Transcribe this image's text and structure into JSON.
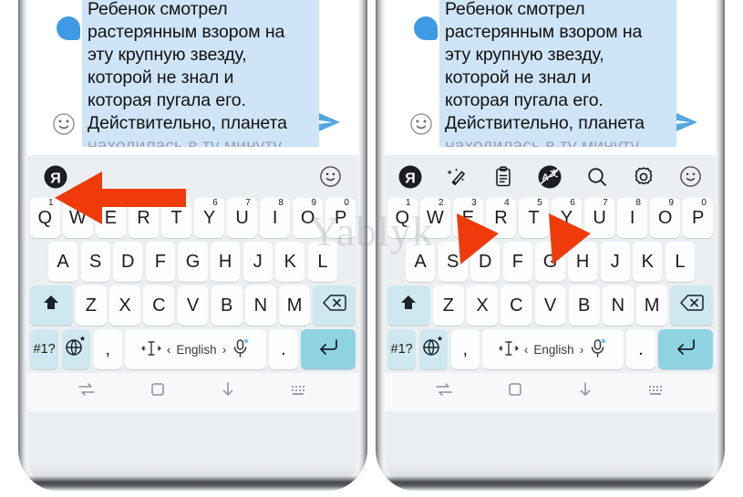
{
  "watermark": "Yablyk",
  "colors": {
    "bubble": "#cfe4f7",
    "avatar": "#3f9ae5",
    "send": "#55a7e0",
    "key_mod": "#cfe7ee",
    "key_enter": "#8fd3e2",
    "keyboard_bg": "#eceff2",
    "arrow": "#ef3b0c",
    "yandex_logo": "#1b1f24"
  },
  "message": {
    "lines": [
      "Ребенок смотрел",
      "растерянным взором на",
      "эту крупную звезду,",
      "которой не знал и",
      "которая пугала его.",
      "Действительно, планета"
    ],
    "clipped_line": "находилась в ту минуту",
    "emoji_button": "emoji-icon",
    "send_button": "send-icon"
  },
  "panels": [
    {
      "id": "left",
      "toolbar": {
        "state": "collapsed",
        "items": [
          {
            "name": "yandex-logo-icon",
            "label": "Я"
          },
          {
            "name": "emoji-icon",
            "label": ""
          }
        ]
      },
      "arrow_target": "yandex-logo-icon"
    },
    {
      "id": "right",
      "toolbar": {
        "state": "expanded",
        "items": [
          {
            "name": "yandex-logo-icon",
            "label": "Я"
          },
          {
            "name": "magic-wand-icon",
            "label": ""
          },
          {
            "name": "clipboard-icon",
            "label": ""
          },
          {
            "name": "translate-icon",
            "label": "A"
          },
          {
            "name": "search-icon",
            "label": ""
          },
          {
            "name": "gear-icon",
            "label": ""
          },
          {
            "name": "emoji-icon",
            "label": ""
          }
        ]
      },
      "arrow_targets": [
        "magic-wand-icon",
        "translate-icon"
      ]
    }
  ],
  "keyboard": {
    "row1": [
      {
        "letter": "Q",
        "num": "1"
      },
      {
        "letter": "W",
        "num": "2"
      },
      {
        "letter": "E",
        "num": "3"
      },
      {
        "letter": "R",
        "num": "4"
      },
      {
        "letter": "T",
        "num": "5"
      },
      {
        "letter": "Y",
        "num": "6"
      },
      {
        "letter": "U",
        "num": "7"
      },
      {
        "letter": "I",
        "num": "8"
      },
      {
        "letter": "O",
        "num": "9"
      },
      {
        "letter": "P",
        "num": "0"
      }
    ],
    "row2": [
      "A",
      "S",
      "D",
      "F",
      "G",
      "H",
      "J",
      "K",
      "L"
    ],
    "row3": {
      "shift": "shift-icon",
      "letters": [
        "Z",
        "X",
        "C",
        "V",
        "B",
        "N",
        "M"
      ],
      "backspace": "backspace-icon"
    },
    "row4": {
      "symbols_label": "#1?",
      "globe": "globe-settings-icon",
      "comma": ",",
      "space": {
        "cursor_icon": "cursor-move-icon",
        "prev": "‹",
        "language": "English",
        "next": "›",
        "mic_icon": "microphone-icon"
      },
      "period": ".",
      "enter": "enter-icon"
    }
  },
  "navbar": {
    "items": [
      {
        "name": "recents-icon"
      },
      {
        "name": "home-icon"
      },
      {
        "name": "hide-keyboard-icon"
      },
      {
        "name": "keyboard-switch-icon"
      }
    ]
  }
}
